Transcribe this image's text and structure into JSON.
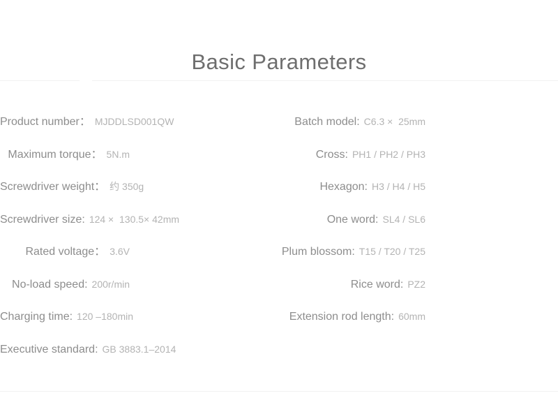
{
  "page": {
    "title": "Basic Parameters",
    "background_color": "#ffffff",
    "title_color": "#6e6e6e",
    "label_color": "#8d8d8d",
    "value_color": "#b3b3b3",
    "divider_color": "#f2f2f2"
  },
  "specs": {
    "left": [
      {
        "label": "Product number：",
        "value": "MJDDLSD001QW"
      },
      {
        "label": "Maximum torque：",
        "value": "5N.m"
      },
      {
        "label": "Screwdriver weight：",
        "value": "约 350g"
      },
      {
        "label": "Screwdriver size:",
        "value": "124 ×  130.5× 42mm"
      },
      {
        "label": "Rated voltage：",
        "value": "3.6V"
      },
      {
        "label": "No-load speed:",
        "value": "200r/min"
      },
      {
        "label": "Charging time:",
        "value": "120 –180min"
      },
      {
        "label": "Executive standard:",
        "value": "GB 3883.1–2014"
      }
    ],
    "right": [
      {
        "label": "Batch model:",
        "value": "C6.3 ×  25mm"
      },
      {
        "label": "Cross:",
        "value": "PH1 / PH2 / PH3"
      },
      {
        "label": "Hexagon:",
        "value": "H3 / H4 / H5"
      },
      {
        "label": "One word:",
        "value": "SL4 / SL6"
      },
      {
        "label": "Plum blossom:",
        "value": "T15 / T20 / T25"
      },
      {
        "label": "Rice word:",
        "value": "PZ2"
      },
      {
        "label": "Extension rod length:",
        "value": "60mm"
      }
    ]
  }
}
